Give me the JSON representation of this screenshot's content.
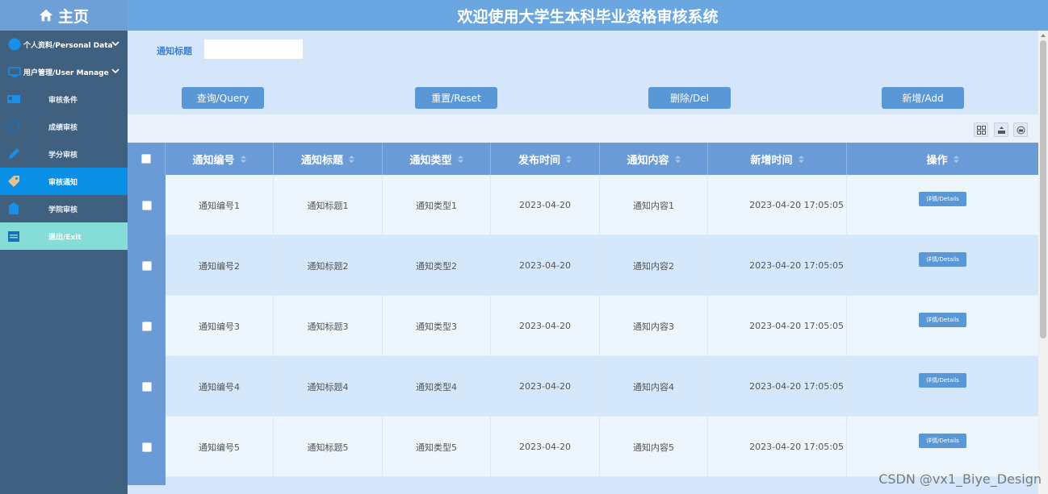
{
  "sidebar": {
    "home_label": "主页",
    "groups": [
      {
        "label": "个人资料/Personal Data"
      },
      {
        "label": "用户管理/User Manage"
      }
    ],
    "items": [
      {
        "label": "审核条件"
      },
      {
        "label": "成绩审核"
      },
      {
        "label": "学分审核"
      },
      {
        "label": "审核通知"
      },
      {
        "label": "学院审核"
      },
      {
        "label": "退出/Exit"
      }
    ]
  },
  "header": {
    "title": "欢迎使用大学生本科毕业资格审核系统"
  },
  "search": {
    "label": "通知标题",
    "value": ""
  },
  "buttons": {
    "query": "查询/Query",
    "reset": "重置/Reset",
    "delete": "删除/Del",
    "add": "新增/Add"
  },
  "table": {
    "columns": [
      "通知编号",
      "通知标题",
      "通知类型",
      "发布时间",
      "通知内容",
      "新增时间",
      "操作"
    ],
    "detail_label": "详情/Details",
    "rows": [
      {
        "no": "通知编号1",
        "title": "通知标题1",
        "type": "通知类型1",
        "publish": "2023-04-20",
        "content": "通知内容1",
        "created": "2023-04-20 17:05:05"
      },
      {
        "no": "通知编号2",
        "title": "通知标题2",
        "type": "通知类型2",
        "publish": "2023-04-20",
        "content": "通知内容2",
        "created": "2023-04-20 17:05:05"
      },
      {
        "no": "通知编号3",
        "title": "通知标题3",
        "type": "通知类型3",
        "publish": "2023-04-20",
        "content": "通知内容3",
        "created": "2023-04-20 17:05:05"
      },
      {
        "no": "通知编号4",
        "title": "通知标题4",
        "type": "通知类型4",
        "publish": "2023-04-20",
        "content": "通知内容4",
        "created": "2023-04-20 17:05:05"
      },
      {
        "no": "通知编号5",
        "title": "通知标题5",
        "type": "通知类型5",
        "publish": "2023-04-20",
        "content": "通知内容5",
        "created": "2023-04-20 17:05:05"
      }
    ]
  },
  "watermark": "CSDN @vx1_Biye_Design",
  "colors": {
    "sidebar_bg": "#40607f",
    "header_bg": "#6aa6e0",
    "active_item": "#0a8fe6",
    "exit_item": "#86dcd6",
    "button": "#5a97d6",
    "table_header": "#6b9bd6"
  }
}
